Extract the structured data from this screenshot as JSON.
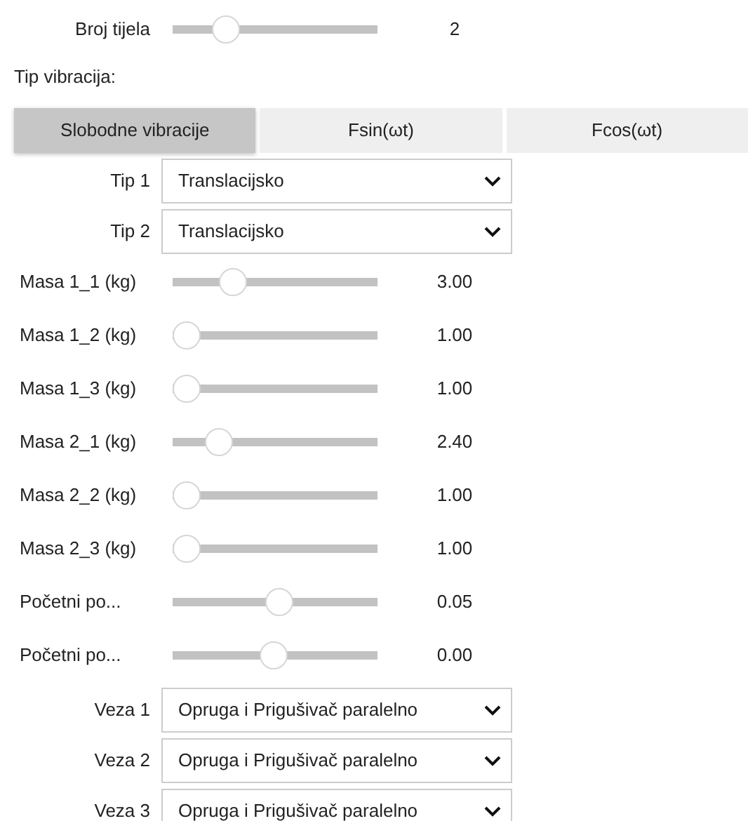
{
  "body_count": {
    "label": "Broj tijela",
    "level": 0.22,
    "reading": "2"
  },
  "vibration_type": {
    "label": "Tip vibracija:",
    "tabs": [
      {
        "label": "Slobodne vibracije",
        "selected": true
      },
      {
        "label": "Fsin(ωt)",
        "selected": false
      },
      {
        "label": "Fcos(ωt)",
        "selected": false
      }
    ]
  },
  "types": [
    {
      "label": "Tip 1",
      "value": "Translacijsko"
    },
    {
      "label": "Tip 2",
      "value": "Translacijsko"
    }
  ],
  "parameters": [
    {
      "label": "Masa 1_1 (kg)",
      "level": 0.26,
      "reading": "3.00"
    },
    {
      "label": "Masa 1_2 (kg)",
      "level": 0,
      "reading": "1.00"
    },
    {
      "label": "Masa 1_3 (kg)",
      "level": 0,
      "reading": "1.00"
    },
    {
      "label": "Masa 2_1 (kg)",
      "level": 0.18,
      "reading": "2.40"
    },
    {
      "label": "Masa 2_2 (kg)",
      "level": 0,
      "reading": "1.00"
    },
    {
      "label": "Masa 2_3 (kg)",
      "level": 0,
      "reading": "1.00"
    },
    {
      "label": "Početni po...",
      "level": 0.52,
      "reading": "0.05"
    },
    {
      "label": "Početni po...",
      "level": 0.49,
      "reading": "0.00"
    }
  ],
  "connections": [
    {
      "label": "Veza 1",
      "value": "Opruga i Prigušivač paralelno"
    },
    {
      "label": "Veza 2",
      "value": "Opruga i Prigušivač paralelno"
    },
    {
      "label": "Veza 3",
      "value": "Opruga i Prigušivač paralelno"
    }
  ]
}
